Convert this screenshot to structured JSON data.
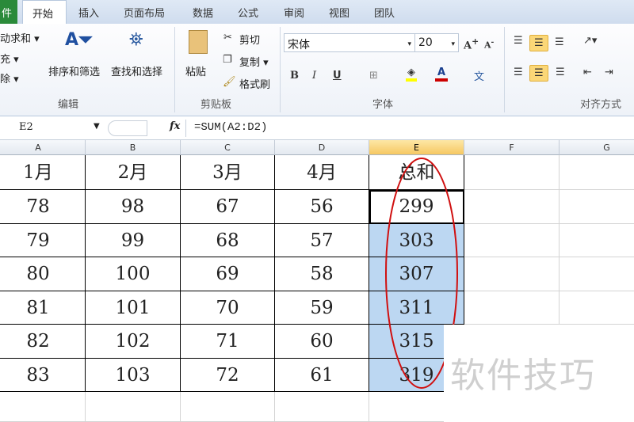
{
  "tabs": {
    "file": "件",
    "items": [
      "开始",
      "插入",
      "页面布局",
      "数据",
      "公式",
      "审阅",
      "视图",
      "团队"
    ]
  },
  "ribbon": {
    "editing": {
      "autosum": "动求和 ▾",
      "fill": "充 ▾",
      "clear": "除 ▾",
      "sort": "排序和筛选",
      "find": "查找和选择",
      "group": "编辑"
    },
    "clipboard": {
      "paste": "粘贴",
      "cut": "剪切",
      "copy": "复制 ▾",
      "painter": "格式刷",
      "group": "剪贴板"
    },
    "font": {
      "name": "宋体",
      "size": "20",
      "bold": "B",
      "italic": "I",
      "underline": "U",
      "group": "字体",
      "fill_color": "#ffff00",
      "font_color": "#cc0000"
    },
    "alignment": {
      "group": "对齐方式"
    }
  },
  "formula_bar": {
    "name_box": "E2",
    "fx": "fx",
    "formula": "=SUM(A2:D2)"
  },
  "columns": [
    "A",
    "B",
    "C",
    "D",
    "E",
    "F",
    "G"
  ],
  "rows": [
    [
      "1月",
      "2月",
      "3月",
      "4月",
      "总和"
    ],
    [
      "78",
      "98",
      "67",
      "56",
      "299"
    ],
    [
      "79",
      "99",
      "68",
      "57",
      "303"
    ],
    [
      "80",
      "100",
      "69",
      "58",
      "307"
    ],
    [
      "81",
      "101",
      "70",
      "59",
      "311"
    ],
    [
      "82",
      "102",
      "71",
      "60",
      "315"
    ],
    [
      "83",
      "103",
      "72",
      "61",
      "319"
    ]
  ],
  "active_cell": "E2",
  "watermark": "软件技巧"
}
